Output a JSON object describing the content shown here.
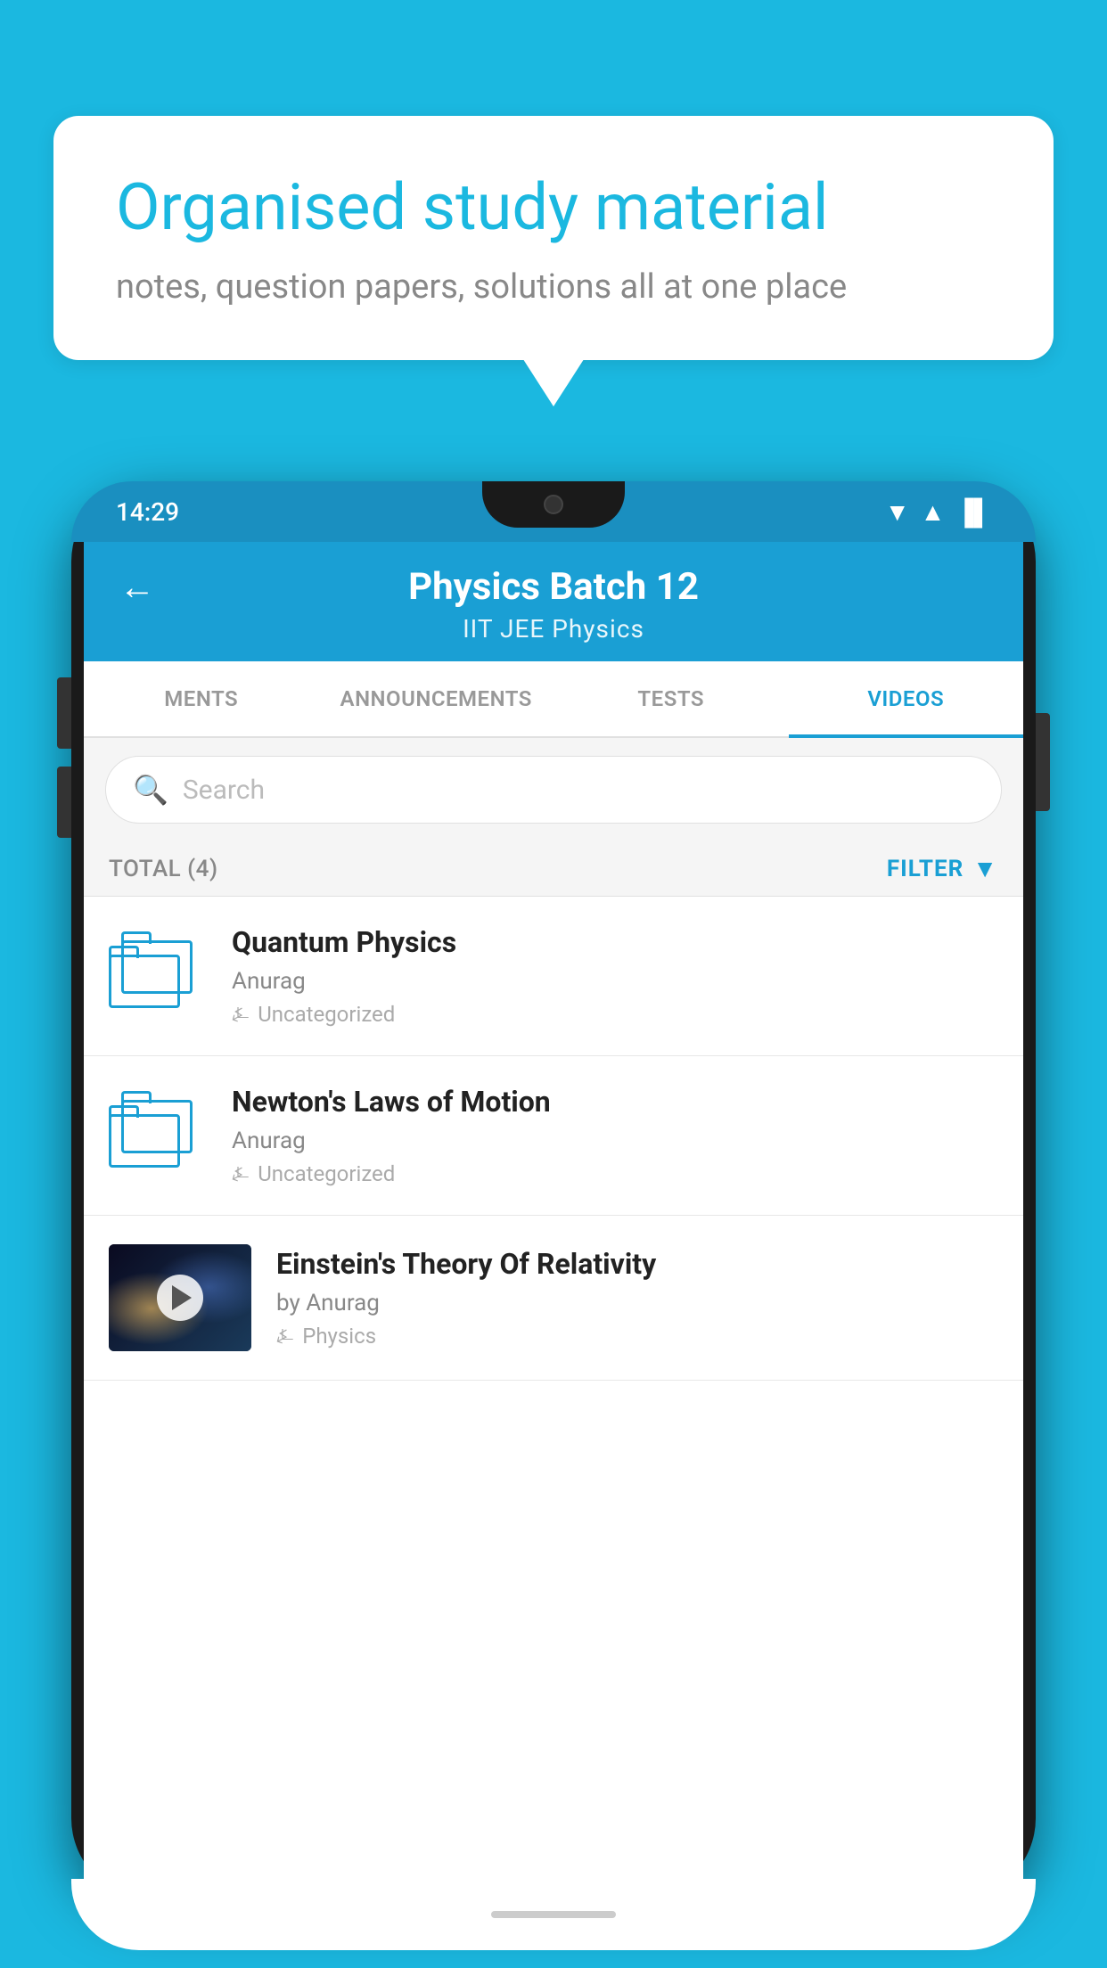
{
  "background_color": "#1bb8e0",
  "hero": {
    "title": "Organised study material",
    "subtitle": "notes, question papers, solutions all at one place"
  },
  "phone": {
    "status_bar": {
      "time": "14:29",
      "wifi": "▼",
      "signal": "▲",
      "battery": "▐"
    },
    "header": {
      "back_label": "←",
      "title": "Physics Batch 12",
      "subtitle": "IIT JEE   Physics"
    },
    "tabs": [
      {
        "label": "MENTS",
        "active": false
      },
      {
        "label": "ANNOUNCEMENTS",
        "active": false
      },
      {
        "label": "TESTS",
        "active": false
      },
      {
        "label": "VIDEOS",
        "active": true
      }
    ],
    "search": {
      "placeholder": "Search"
    },
    "filter": {
      "total_label": "TOTAL (4)",
      "filter_label": "FILTER"
    },
    "videos": [
      {
        "title": "Quantum Physics",
        "author": "Anurag",
        "tag": "Uncategorized",
        "has_thumb": false
      },
      {
        "title": "Newton's Laws of Motion",
        "author": "Anurag",
        "tag": "Uncategorized",
        "has_thumb": false
      },
      {
        "title": "Einstein's Theory Of Relativity",
        "author": "by Anurag",
        "tag": "Physics",
        "has_thumb": true
      }
    ]
  }
}
